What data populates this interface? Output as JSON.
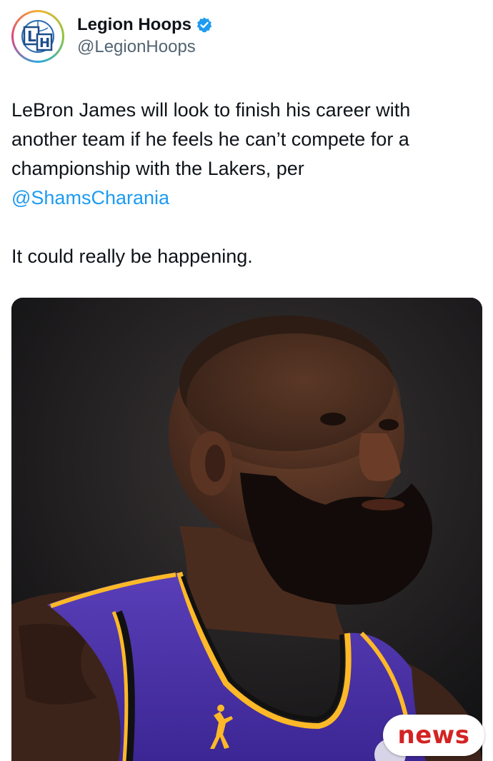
{
  "author": {
    "display_name": "Legion Hoops",
    "handle": "@LegionHoops",
    "verified_icon": "verified-badge-icon",
    "avatar_icon": "legion-hoops-logo-icon",
    "avatar_monogram": "LH"
  },
  "tweet": {
    "text_line_1": "LeBron James will look to finish his career with another team if he feels he can’t compete for a championship with the Lakers, per",
    "mention": "@ShamsCharania",
    "text_line_2": "It could really be happening."
  },
  "media": {
    "description_icon": "basketball-player-photo",
    "jersey_accent": "#4b2e83",
    "jersey_trim": "#fdb927"
  },
  "watermark": {
    "label": "news"
  },
  "colors": {
    "text": "#0f1419",
    "secondary": "#536471",
    "link": "#1d9bf0",
    "verified": "#1d9bf0",
    "watermark": "#d42323"
  }
}
